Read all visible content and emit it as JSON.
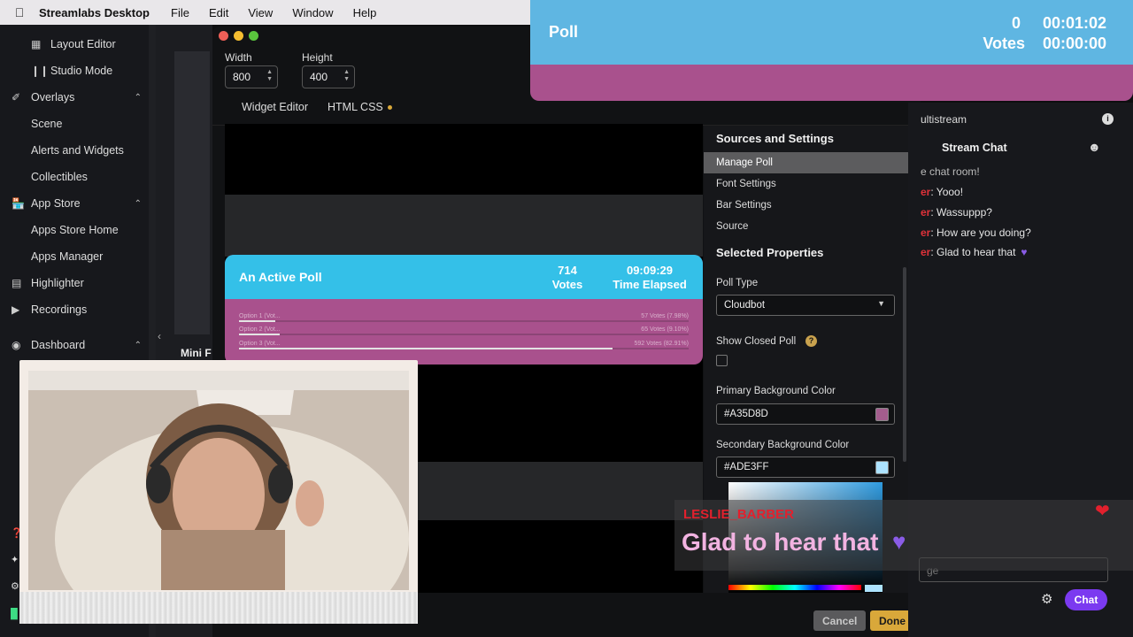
{
  "menubar": {
    "app": "Streamlabs Desktop",
    "items": [
      "File",
      "Edit",
      "View",
      "Window",
      "Help"
    ]
  },
  "sidebar": {
    "layout_editor": "Layout Editor",
    "studio_mode": "Studio Mode",
    "overlays": "Overlays",
    "scene": "Scene",
    "alerts_widgets": "Alerts and Widgets",
    "collectibles": "Collectibles",
    "app_store": "App Store",
    "apps_store_home": "Apps Store Home",
    "apps_manager": "Apps Manager",
    "highlighter": "Highlighter",
    "recordings": "Recordings",
    "dashboard": "Dashboard",
    "mini_label": "Mini F"
  },
  "editor": {
    "width_label": "Width",
    "width_value": "800",
    "height_label": "Height",
    "height_value": "400",
    "tab_widget": "Widget Editor",
    "tab_css": "HTML CSS"
  },
  "poll_preview": {
    "title": "An Active Poll",
    "votes_count": "714",
    "votes_label": "Votes",
    "time": "09:09:29",
    "time_label": "Time Elapsed",
    "options": [
      {
        "label": "Option 1 (Vot...",
        "result": "57 Votes (7.98%)",
        "fraction": 0.08
      },
      {
        "label": "Option 2 (Vot...",
        "result": "65 Votes (9.10%)",
        "fraction": 0.09
      },
      {
        "label": "Option 3 (Vot...",
        "result": "592 Votes (82.91%)",
        "fraction": 0.83
      }
    ]
  },
  "settings": {
    "sources_header": "Sources and Settings",
    "manage_poll": "Manage Poll",
    "font_settings": "Font Settings",
    "bar_settings": "Bar Settings",
    "source": "Source",
    "selected_header": "Selected Properties",
    "poll_type_label": "Poll Type",
    "poll_type_value": "Cloudbot",
    "show_closed_label": "Show Closed Poll",
    "primary_label": "Primary Background Color",
    "primary_value": "#A35D8D",
    "secondary_label": "Secondary Background Color",
    "secondary_value": "#ADE3FF",
    "cancel": "Cancel",
    "done": "Done"
  },
  "chat": {
    "multistream": "ultistream",
    "title": "Stream Chat",
    "welcome": "e chat room!",
    "messages": [
      {
        "user": "er",
        "text": ": Yooo!"
      },
      {
        "user": "er",
        "text": ": Wassuppp?"
      },
      {
        "user": "er",
        "text": ": How are you doing?"
      },
      {
        "user": "er",
        "text": ": Glad to hear that"
      }
    ],
    "input_placeholder": "ge",
    "chat_button": "Chat"
  },
  "banner": {
    "title": "Poll",
    "votes_count": "0",
    "votes_label": "Votes",
    "time1": "00:01:02",
    "time2": "00:00:00"
  },
  "alert": {
    "username": "LESLIE_BARBER",
    "message": "Glad to hear that"
  },
  "colors": {
    "poll_header": "#34c0e8",
    "poll_body": "#a9518d",
    "banner_top": "#5fb6e2",
    "primary_swatch": "#a35d8d",
    "secondary_swatch": "#ade3ff",
    "accent_done": "#d9a83a",
    "chat_button": "#7b3af0"
  }
}
